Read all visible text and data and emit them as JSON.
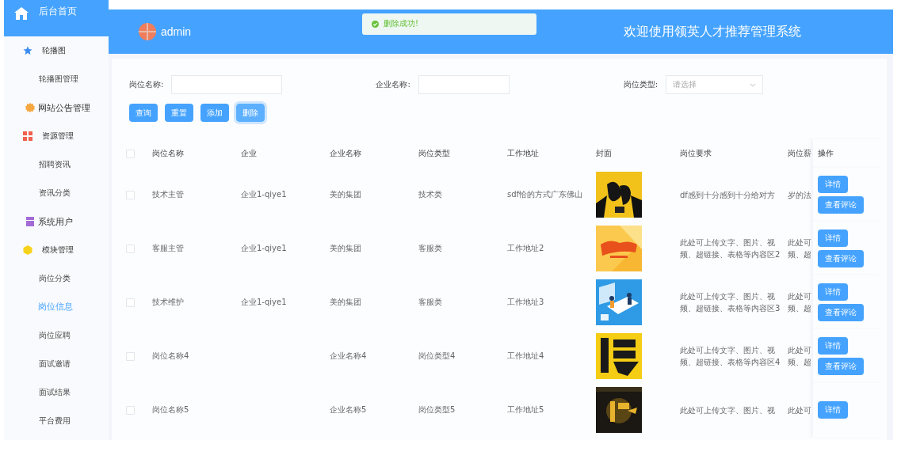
{
  "sidebar": {
    "home": {
      "label": "后台首页"
    },
    "groups": [
      {
        "label": "轮播图",
        "color": "#3d8ef0",
        "children": [
          {
            "label": "轮播图管理",
            "selected": false
          }
        ]
      },
      {
        "label": "网站公告管理",
        "color": "#f5a742"
      },
      {
        "label": "资源管理",
        "color": "#f0604d",
        "children": [
          {
            "label": "招聘资讯",
            "selected": false
          },
          {
            "label": "资讯分类",
            "selected": false
          }
        ]
      },
      {
        "label": "系统用户",
        "color": "#a36bd6"
      },
      {
        "label": "模块管理",
        "color": "#f7d21b",
        "children": [
          {
            "label": "岗位分类",
            "selected": false
          },
          {
            "label": "岗位信息",
            "selected": true
          },
          {
            "label": "岗位应聘",
            "selected": false
          },
          {
            "label": "面试邀请",
            "selected": false
          },
          {
            "label": "面试结果",
            "selected": false
          },
          {
            "label": "平台费用",
            "selected": false
          }
        ]
      }
    ]
  },
  "header": {
    "user": "admin",
    "toast": {
      "message": "删除成功!"
    },
    "title": "欢迎使用领英人才推荐管理系统"
  },
  "search": {
    "fields": [
      {
        "label": "岗位名称:",
        "kind": "input"
      },
      {
        "label": "企业名称:",
        "kind": "input"
      },
      {
        "label": "岗位类型:",
        "kind": "select",
        "placeholder": "请选择"
      }
    ],
    "buttons": [
      {
        "label": "查询",
        "focused": false
      },
      {
        "label": "重置",
        "focused": false
      },
      {
        "label": "添加",
        "focused": false
      },
      {
        "label": "删除",
        "focused": true
      }
    ]
  },
  "table": {
    "header_checked": false,
    "columns": [
      "岗位名称",
      "企业",
      "企业名称",
      "岗位类型",
      "工作地址",
      "封面",
      "岗位要求",
      "岗位薪",
      "操作"
    ],
    "rows": [
      {
        "checked": false,
        "cells": [
          "技术主管",
          "企业1-qiye1",
          "美的集团",
          "技术类",
          "sdf恰的方式广东佛山"
        ],
        "requirement": "df感到十分感到十分给对方",
        "salary": [
          "岁的法"
        ],
        "actions": [
          "详情",
          "查看评论"
        ]
      },
      {
        "checked": false,
        "cells": [
          "客服主管",
          "企业1-qiye1",
          "美的集团",
          "客服类",
          "工作地址2"
        ],
        "requirement": "此处可上传文字、图片、视频、超链接、表格等内容区2",
        "salary": [
          "此处可",
          "频、超"
        ],
        "actions": [
          "详情",
          "查看评论"
        ]
      },
      {
        "checked": false,
        "cells": [
          "技术维护",
          "企业1-qiye1",
          "美的集团",
          "客服类",
          "工作地址3"
        ],
        "requirement": "此处可上传文字、图片、视频、超链接、表格等内容区3",
        "salary": [
          "此处可",
          "频、超"
        ],
        "actions": [
          "详情",
          "查看评论"
        ]
      },
      {
        "checked": false,
        "cells": [
          "岗位名称4",
          "",
          "企业名称4",
          "岗位类型4",
          "工作地址4"
        ],
        "requirement": "此处可上传文字、图片、视频、超链接、表格等内容区4",
        "salary": [
          "此处可",
          "频、超"
        ],
        "actions": [
          "详情",
          "查看评论"
        ]
      },
      {
        "checked": false,
        "cells": [
          "岗位名称5",
          "",
          "企业名称5",
          "岗位类型5",
          "工作地址5"
        ],
        "requirement": "此处可上传文字、图片、视",
        "salary": [
          "此处可"
        ],
        "actions": [
          "详情"
        ]
      }
    ]
  }
}
